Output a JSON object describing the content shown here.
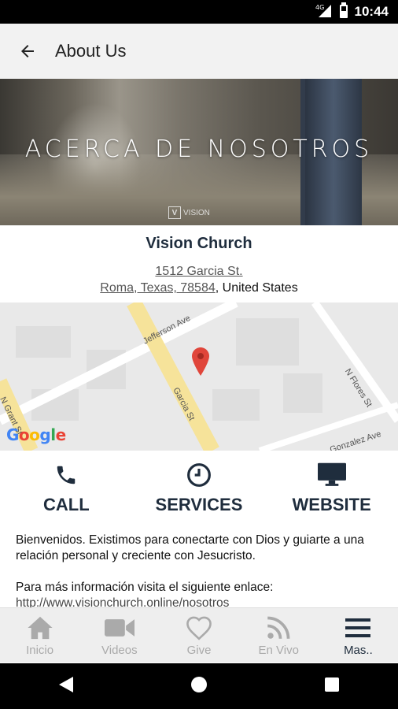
{
  "status_bar": {
    "time": "10:44",
    "network": "4G"
  },
  "app_bar": {
    "title": "About Us",
    "back_icon": "arrow-left-icon"
  },
  "hero": {
    "text": "ACERCA DE NOSOTROS",
    "logo_text": "VISION"
  },
  "church": {
    "name": "Vision Church",
    "address_line1": "1512 Garcia St.",
    "address_line2": "Roma, Texas, 78584",
    "country": ", United States"
  },
  "map": {
    "street_labels": [
      "Jefferson Ave",
      "Garcia St",
      "N Flores St",
      "Gonzalez Ave",
      "N Grant St"
    ],
    "provider": "Google"
  },
  "actions": [
    {
      "label": "CALL",
      "icon": "phone-icon"
    },
    {
      "label": "SERVICES",
      "icon": "clock-icon"
    },
    {
      "label": "WEBSITE",
      "icon": "monitor-icon"
    }
  ],
  "description": {
    "paragraph1": "Bienvenidos. Existimos para conectarte con Dios y guiarte a una relación personal y creciente con Jesucristo.",
    "paragraph2": "Para más información visita el siguiente enlace:",
    "link": "http://www.visionchurch.online/nosotros"
  },
  "tabs": [
    {
      "label": "Inicio",
      "icon": "home-icon"
    },
    {
      "label": "Videos",
      "icon": "video-camera-icon"
    },
    {
      "label": "Give",
      "icon": "heart-icon"
    },
    {
      "label": "En Vivo",
      "icon": "rss-icon"
    },
    {
      "label": "Mas..",
      "icon": "menu-icon",
      "active": true
    }
  ],
  "colors": {
    "accent": "#1f2d3d",
    "inactive": "#aaaaaa",
    "map_road": "#f6e39a",
    "pin": "#e0453a"
  }
}
